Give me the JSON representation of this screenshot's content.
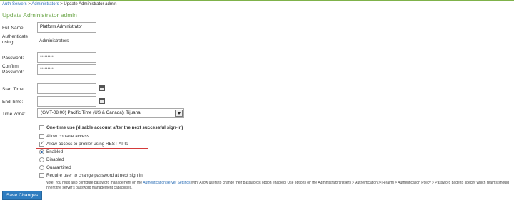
{
  "breadcrumb": {
    "items": [
      "Auth Servers",
      "Administrators",
      "Update Administrator admin"
    ],
    "separator": ">"
  },
  "page_title": "Update Administrator admin",
  "form": {
    "full_name": {
      "label": "Full Name:",
      "value": "Platform Administrator"
    },
    "authenticate_using": {
      "label": "Authenticate using:",
      "value": "Administrators"
    },
    "password": {
      "label": "Password:",
      "value": "•••••••••"
    },
    "confirm_password": {
      "label": "Confirm Password:",
      "value": "•••••••••"
    },
    "start_time": {
      "label": "Start Time:",
      "value": ""
    },
    "end_time": {
      "label": "End Time:",
      "value": ""
    },
    "time_zone": {
      "label": "Time Zone:",
      "value": "(GMT-08:00) Pacific Time (US & Canada); Tijuana"
    }
  },
  "options": {
    "one_time_use": {
      "label": "One-time use (disable account after the next successful sign-in)",
      "checked": false
    },
    "allow_console": {
      "label": "Allow console access",
      "checked": false
    },
    "allow_profiler": {
      "label": "Allow access to profiler using REST APIs",
      "checked": true
    },
    "status": [
      {
        "label": "Enabled",
        "selected": true
      },
      {
        "label": "Disabled",
        "selected": false
      },
      {
        "label": "Quarantined",
        "selected": false
      }
    ],
    "require_pw_change": {
      "label": "Require user to change password at next sign in",
      "checked": false
    }
  },
  "note": {
    "prefix": "Note: You must also configure password management on the ",
    "link": "Authentication server Settings",
    "suffix": " with 'Allow users to change their passwords' option enabled. Use options on the Administrators/Users > Authentication > [Realm] > Authentication Policy > Password page to specify which realms should inherit the server's password management capabilities."
  },
  "save_button": "Save Changes",
  "colors": {
    "title_green": "#6fa84c",
    "link_blue": "#2a6db5",
    "highlight_red": "#d43a3a",
    "button_blue": "#2f7dc0"
  },
  "icons": {
    "calendar": "calendar-icon",
    "dropdown": "chevron-down-icon"
  }
}
